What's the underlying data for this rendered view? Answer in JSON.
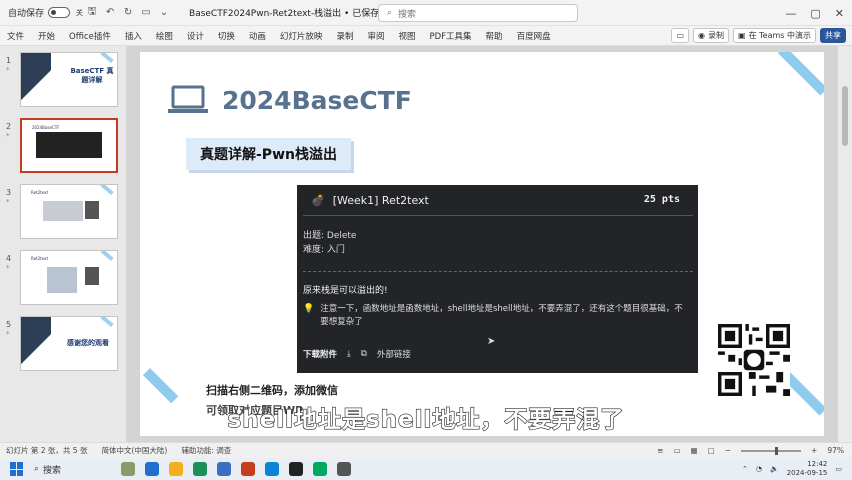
{
  "titlebar": {
    "autosave_label": "自动保存",
    "autosave_state": "关",
    "doc_title": "BaseCTF2024Pwn-Ret2text-栈溢出 • 已保存到这台电脑",
    "search_placeholder": "搜索"
  },
  "ribbon": {
    "tabs": [
      "文件",
      "开始",
      "Office插件",
      "插入",
      "绘图",
      "设计",
      "切换",
      "动画",
      "幻灯片放映",
      "录制",
      "审阅",
      "视图",
      "PDF工具集",
      "帮助",
      "百度网盘"
    ],
    "record_label": "录制",
    "teams_label": "在 Teams 中演示",
    "share_label": "共享"
  },
  "thumbnails": [
    {
      "num": "1",
      "star": "*",
      "title": "BaseCTF 真题详解"
    },
    {
      "num": "2",
      "star": "*",
      "title": "2024BaseCTF"
    },
    {
      "num": "3",
      "star": "*",
      "title": "Ret2text"
    },
    {
      "num": "4",
      "star": "*",
      "title": "Ret2text"
    },
    {
      "num": "5",
      "star": "*",
      "title": "感谢您的观看"
    }
  ],
  "slide": {
    "title": "2024BaseCTF",
    "subtitle": "真题详解-Pwn栈溢出",
    "card": {
      "title": "[Week1] Ret2text",
      "points": "25 pts",
      "author": "出题: Delete",
      "difficulty": "难度: 入门",
      "description": "原来栈是可以溢出的!",
      "tip": "注意一下，函数地址是函数地址，shell地址是shell地址，不要弄混了，还有这个题目很基础，不要想复杂了",
      "download_label": "下载附件",
      "external_link_label": "外部链接"
    },
    "wechat_text": "扫描右侧二维码，添加微信",
    "lower_text": "可领取对应题目WP"
  },
  "caption": "shell地址是shell地址，不要弄混了",
  "statusbar": {
    "slide_info": "幻灯片 第 2 张，共 5 张",
    "language": "简体中文(中国大陆)",
    "accessibility": "辅助功能: 调查",
    "zoom": "97%"
  },
  "taskbar": {
    "search_label": "搜索",
    "time": "12:42",
    "date": "2024-09-15"
  }
}
